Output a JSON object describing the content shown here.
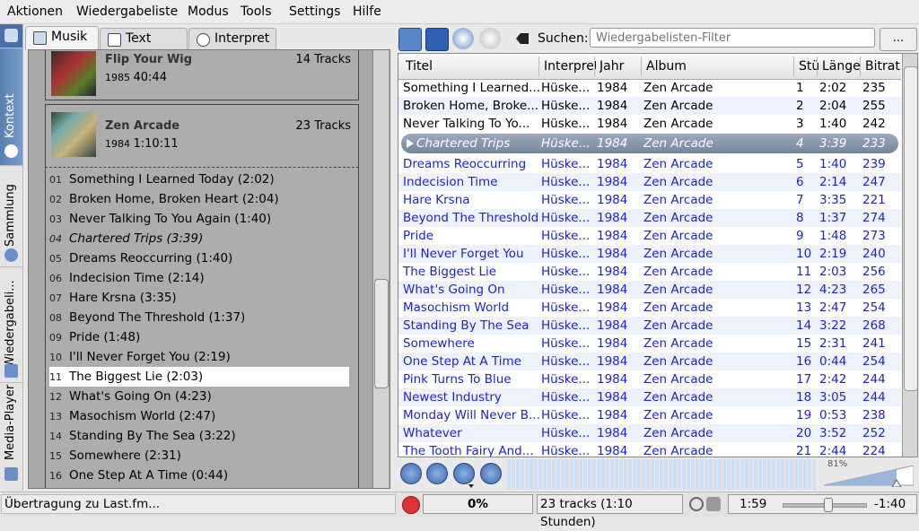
{
  "menu": [
    "Aktionen",
    "Wiedergabeliste",
    "Modus",
    "Tools",
    "Settings",
    "Hilfe"
  ],
  "side_tabs": [
    "Kontext",
    "Sammlung",
    "Wiedergabeli...",
    "Media-Player"
  ],
  "left_tabs": [
    "Musik",
    "Text",
    "Interpret"
  ],
  "albums": [
    {
      "title": "Flip Your Wig",
      "year": "1985",
      "length": "40:44",
      "tracks": "14 Tracks"
    },
    {
      "title": "Zen Arcade",
      "year": "1984",
      "length": "1:10:11",
      "tracks": "23 Tracks"
    }
  ],
  "tracklist": [
    {
      "no": "01",
      "text": "Something I Learned Today (2:02)"
    },
    {
      "no": "02",
      "text": "Broken Home, Broken Heart (2:04)"
    },
    {
      "no": "03",
      "text": "Never Talking To You Again (1:40)"
    },
    {
      "no": "04",
      "text": "Chartered Trips (3:39)"
    },
    {
      "no": "05",
      "text": "Dreams Reoccurring (1:40)"
    },
    {
      "no": "06",
      "text": "Indecision Time (2:14)"
    },
    {
      "no": "07",
      "text": "Hare Krsna (3:35)"
    },
    {
      "no": "08",
      "text": "Beyond The Threshold (1:37)"
    },
    {
      "no": "09",
      "text": "Pride (1:48)"
    },
    {
      "no": "10",
      "text": "I'll Never Forget You (2:19)"
    },
    {
      "no": "11",
      "text": "The Biggest Lie (2:03)"
    },
    {
      "no": "12",
      "text": "What's Going On (4:23)"
    },
    {
      "no": "13",
      "text": "Masochism World (2:47)"
    },
    {
      "no": "14",
      "text": "Standing By The Sea (3:22)"
    },
    {
      "no": "15",
      "text": "Somewhere (2:31)"
    },
    {
      "no": "16",
      "text": "One Step At A Time (0:44)"
    }
  ],
  "search": {
    "label": "Suchen:",
    "placeholder": "Wiedergabelisten-Filter",
    "more": "..."
  },
  "playlist": {
    "columns": [
      "Titel",
      "Interpret",
      "Jahr",
      "Album",
      "Stü",
      "Länge",
      "Bitrat"
    ],
    "rows": [
      [
        "Something I Learned...",
        "Hüske...",
        "1984",
        "Zen Arcade",
        "1",
        "2:02",
        "235"
      ],
      [
        "Broken Home, Broke...",
        "Hüske...",
        "1984",
        "Zen Arcade",
        "2",
        "2:04",
        "255"
      ],
      [
        "Never Talking To Yo...",
        "Hüske...",
        "1984",
        "Zen Arcade",
        "3",
        "1:40",
        "242"
      ],
      [
        "Chartered Trips",
        "Hüske...",
        "1984",
        "Zen Arcade",
        "4",
        "3:39",
        "233"
      ],
      [
        "Dreams Reoccurring",
        "Hüske...",
        "1984",
        "Zen Arcade",
        "5",
        "1:40",
        "239"
      ],
      [
        "Indecision Time",
        "Hüske...",
        "1984",
        "Zen Arcade",
        "6",
        "2:14",
        "247"
      ],
      [
        "Hare Krsna",
        "Hüske...",
        "1984",
        "Zen Arcade",
        "7",
        "3:35",
        "221"
      ],
      [
        "Beyond The Threshold",
        "Hüske...",
        "1984",
        "Zen Arcade",
        "8",
        "1:37",
        "274"
      ],
      [
        "Pride",
        "Hüske...",
        "1984",
        "Zen Arcade",
        "9",
        "1:48",
        "273"
      ],
      [
        "I'll Never Forget You",
        "Hüske...",
        "1984",
        "Zen Arcade",
        "10",
        "2:19",
        "240"
      ],
      [
        "The Biggest Lie",
        "Hüske...",
        "1984",
        "Zen Arcade",
        "11",
        "2:03",
        "256"
      ],
      [
        "What's Going On",
        "Hüske...",
        "1984",
        "Zen Arcade",
        "12",
        "4:23",
        "265"
      ],
      [
        "Masochism World",
        "Hüske...",
        "1984",
        "Zen Arcade",
        "13",
        "2:47",
        "254"
      ],
      [
        "Standing By The Sea",
        "Hüske...",
        "1984",
        "Zen Arcade",
        "14",
        "3:22",
        "268"
      ],
      [
        "Somewhere",
        "Hüske...",
        "1984",
        "Zen Arcade",
        "15",
        "2:31",
        "241"
      ],
      [
        "One Step At A Time",
        "Hüske...",
        "1984",
        "Zen Arcade",
        "16",
        "0:44",
        "254"
      ],
      [
        "Pink Turns To Blue",
        "Hüske...",
        "1984",
        "Zen Arcade",
        "17",
        "2:42",
        "244"
      ],
      [
        "Newest Industry",
        "Hüske...",
        "1984",
        "Zen Arcade",
        "18",
        "3:05",
        "244"
      ],
      [
        "Monday Will Never B...",
        "Hüske...",
        "1984",
        "Zen Arcade",
        "19",
        "0:53",
        "238"
      ],
      [
        "Whatever",
        "Hüske...",
        "1984",
        "Zen Arcade",
        "20",
        "3:52",
        "252"
      ],
      [
        "The Tooth Fairy And...",
        "Hüske...",
        "1984",
        "Zen Arcade",
        "21",
        "2:44",
        "224"
      ]
    ]
  },
  "volume": {
    "label": "81%",
    "level": 0.81
  },
  "status": {
    "message": "Übertragung zu Last.fm...",
    "progress": "0%",
    "summary": "23 tracks (1:10 Stunden)",
    "elapsed": "1:59",
    "remaining": "-1:40",
    "position": 0.54
  },
  "colors": {
    "upcoming": "#2222cc",
    "current_bar": "#75879b",
    "accent": "#3b67b0"
  }
}
